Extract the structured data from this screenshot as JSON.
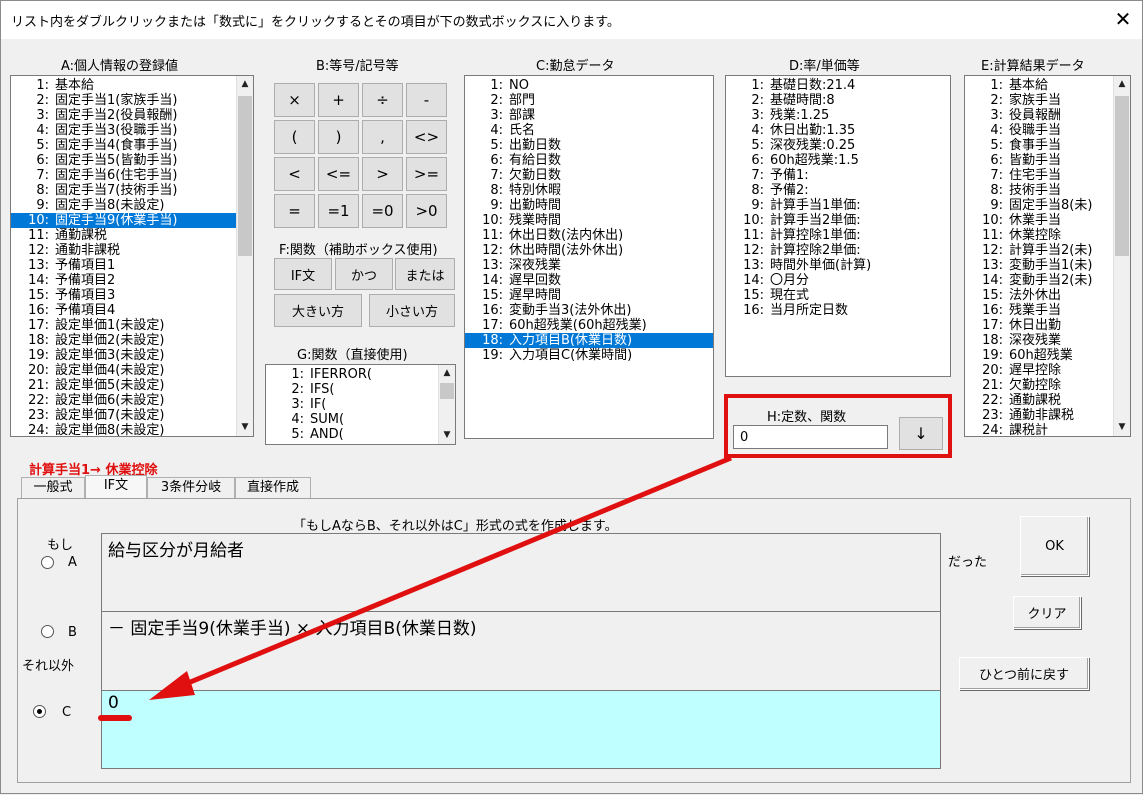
{
  "window": {
    "title": "リスト内をダブルクリックまたは「数式に」をクリックするとその項目が下の数式ボックスに入ります。",
    "close": "✕"
  },
  "listA": {
    "caption": "A:個人情報の登録値",
    "items": [
      {
        "n": "1:",
        "t": "基本給"
      },
      {
        "n": "2:",
        "t": "固定手当1(家族手当)"
      },
      {
        "n": "3:",
        "t": "固定手当2(役員報酬)"
      },
      {
        "n": "4:",
        "t": "固定手当3(役職手当)"
      },
      {
        "n": "5:",
        "t": "固定手当4(食事手当)"
      },
      {
        "n": "6:",
        "t": "固定手当5(皆勤手当)"
      },
      {
        "n": "7:",
        "t": "固定手当6(住宅手当)"
      },
      {
        "n": "8:",
        "t": "固定手当7(技術手当)"
      },
      {
        "n": "9:",
        "t": "固定手当8(未設定)"
      },
      {
        "n": "10:",
        "t": "固定手当9(休業手当)"
      },
      {
        "n": "11:",
        "t": "通勤課税"
      },
      {
        "n": "12:",
        "t": "通勤非課税"
      },
      {
        "n": "13:",
        "t": "予備項目1"
      },
      {
        "n": "14:",
        "t": "予備項目2"
      },
      {
        "n": "15:",
        "t": "予備項目3"
      },
      {
        "n": "16:",
        "t": "予備項目4"
      },
      {
        "n": "17:",
        "t": "設定単価1(未設定)"
      },
      {
        "n": "18:",
        "t": "設定単価2(未設定)"
      },
      {
        "n": "19:",
        "t": "設定単価3(未設定)"
      },
      {
        "n": "20:",
        "t": "設定単価4(未設定)"
      },
      {
        "n": "21:",
        "t": "設定単価5(未設定)"
      },
      {
        "n": "22:",
        "t": "設定単価6(未設定)"
      },
      {
        "n": "23:",
        "t": "設定単価7(未設定)"
      },
      {
        "n": "24:",
        "t": "設定単価8(未設定)"
      }
    ]
  },
  "listB": {
    "caption": "B:等号/記号等",
    "buttons": [
      "×",
      "+",
      "÷",
      "-",
      "(",
      ")",
      ",",
      "<>",
      "<",
      "<=",
      ">",
      ">=",
      "=",
      "=1",
      "=0",
      ">0"
    ]
  },
  "listF": {
    "caption": "F:関数（補助ボックス使用)",
    "buttons": [
      "IF文",
      "かつ",
      "または",
      "大きい方",
      "小さい方"
    ]
  },
  "listG": {
    "caption": "G:関数（直接使用)",
    "items": [
      {
        "n": "1:",
        "t": "IFERROR("
      },
      {
        "n": "2:",
        "t": "IFS("
      },
      {
        "n": "3:",
        "t": "IF("
      },
      {
        "n": "4:",
        "t": "SUM("
      },
      {
        "n": "5:",
        "t": "AND("
      }
    ]
  },
  "listC": {
    "caption": "C:勤怠データ",
    "items": [
      {
        "n": "1:",
        "t": "NO"
      },
      {
        "n": "2:",
        "t": "部門"
      },
      {
        "n": "3:",
        "t": "部課"
      },
      {
        "n": "4:",
        "t": "氏名"
      },
      {
        "n": "5:",
        "t": "出勤日数"
      },
      {
        "n": "6:",
        "t": "有給日数"
      },
      {
        "n": "7:",
        "t": "欠勤日数"
      },
      {
        "n": "8:",
        "t": "特別休暇"
      },
      {
        "n": "9:",
        "t": "出勤時間"
      },
      {
        "n": "10:",
        "t": "残業時間"
      },
      {
        "n": "11:",
        "t": "休出日数(法内休出)"
      },
      {
        "n": "12:",
        "t": "休出時間(法外休出)"
      },
      {
        "n": "13:",
        "t": "深夜残業"
      },
      {
        "n": "14:",
        "t": "遅早回数"
      },
      {
        "n": "15:",
        "t": "遅早時間"
      },
      {
        "n": "16:",
        "t": "変動手当3(法外休出)"
      },
      {
        "n": "17:",
        "t": "60h超残業(60h超残業)"
      },
      {
        "n": "18:",
        "t": "入力項目B(休業日数)"
      },
      {
        "n": "19:",
        "t": "入力項目C(休業時間)"
      }
    ]
  },
  "listD": {
    "caption": "D:率/単価等",
    "items": [
      {
        "n": "1:",
        "t": "基礎日数:21.4"
      },
      {
        "n": "2:",
        "t": "基礎時間:8"
      },
      {
        "n": "3:",
        "t": "残業:1.25"
      },
      {
        "n": "4:",
        "t": "休日出勤:1.35"
      },
      {
        "n": "5:",
        "t": "深夜残業:0.25"
      },
      {
        "n": "6:",
        "t": "60h超残業:1.5"
      },
      {
        "n": "7:",
        "t": "予備1:"
      },
      {
        "n": "8:",
        "t": "予備2:"
      },
      {
        "n": "9:",
        "t": "計算手当1単価:"
      },
      {
        "n": "10:",
        "t": "計算手当2単価:"
      },
      {
        "n": "11:",
        "t": "計算控除1単価:"
      },
      {
        "n": "12:",
        "t": "計算控除2単価:"
      },
      {
        "n": "13:",
        "t": "時間外単価(計算)"
      },
      {
        "n": "14:",
        "t": "〇月分"
      },
      {
        "n": "15:",
        "t": "現在式"
      },
      {
        "n": "16:",
        "t": "当月所定日数"
      }
    ]
  },
  "listE": {
    "caption": "E:計算結果データ",
    "items": [
      {
        "n": "1:",
        "t": "基本給"
      },
      {
        "n": "2:",
        "t": "家族手当"
      },
      {
        "n": "3:",
        "t": "役員報酬"
      },
      {
        "n": "4:",
        "t": "役職手当"
      },
      {
        "n": "5:",
        "t": "食事手当"
      },
      {
        "n": "6:",
        "t": "皆勤手当"
      },
      {
        "n": "7:",
        "t": "住宅手当"
      },
      {
        "n": "8:",
        "t": "技術手当"
      },
      {
        "n": "9:",
        "t": "固定手当8(未)"
      },
      {
        "n": "10:",
        "t": "休業手当"
      },
      {
        "n": "11:",
        "t": "休業控除"
      },
      {
        "n": "12:",
        "t": "計算手当2(未)"
      },
      {
        "n": "13:",
        "t": "変動手当1(未)"
      },
      {
        "n": "14:",
        "t": "変動手当2(未)"
      },
      {
        "n": "15:",
        "t": "法外休出"
      },
      {
        "n": "16:",
        "t": "残業手当"
      },
      {
        "n": "17:",
        "t": "休日出勤"
      },
      {
        "n": "18:",
        "t": "深夜残業"
      },
      {
        "n": "19:",
        "t": "60h超残業"
      },
      {
        "n": "20:",
        "t": "遅早控除"
      },
      {
        "n": "21:",
        "t": "欠勤控除"
      },
      {
        "n": "22:",
        "t": "通勤課税"
      },
      {
        "n": "23:",
        "t": "通勤非課税"
      },
      {
        "n": "24:",
        "t": "課税計"
      }
    ]
  },
  "constH": {
    "caption": "H:定数、関数",
    "value": "0",
    "insert_button": "↓"
  },
  "target": {
    "label": "計算手当1→  休業控除"
  },
  "tabs": [
    "一般式",
    "IF文",
    "3条件分岐",
    "直接作成"
  ],
  "ifpanel": {
    "description": "「もしAならB、それ以外はC」形式の式を作成します。",
    "label_if": "もし",
    "label_else": "それ以外",
    "label_datta": "だった",
    "radioA": "A",
    "radioB": "B",
    "radioC": "C",
    "exprA": "給与区分が月給者",
    "exprB": "－ 固定手当9(休業手当) × 入力項目B(休業日数)",
    "exprC": "0",
    "ok": "OK",
    "clear": "クリア",
    "undo": "ひとつ前に戻す"
  },
  "colors": {
    "selection": "#0078d7",
    "highlight": "#e01010",
    "exprC_bg": "#c0ffff"
  }
}
